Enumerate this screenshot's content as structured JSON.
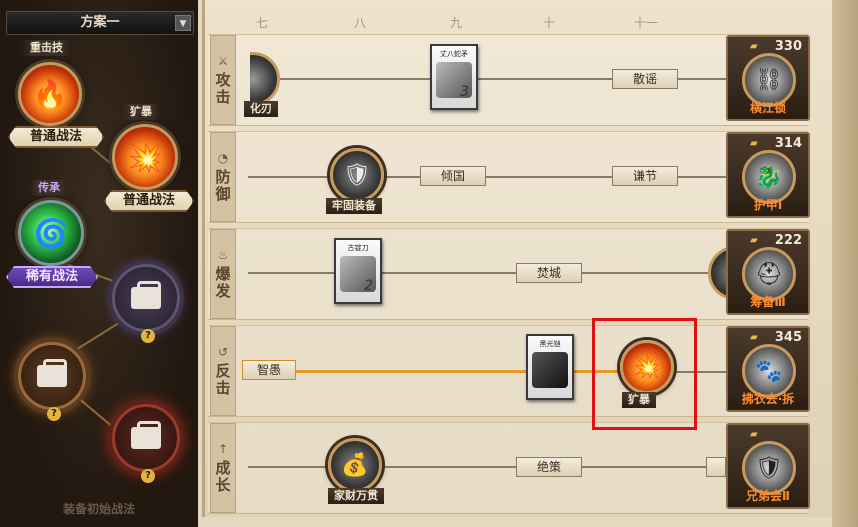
{
  "left_panel": {
    "plan_select": {
      "value": "方案一",
      "arrow_icon": "dropdown-arrow-icon"
    },
    "tags": {
      "heavy_attack": "重击技",
      "fierce": "犷暴",
      "inherit": "传承"
    },
    "labels": {
      "normal_tactic_1": "普通战法",
      "normal_tactic_2": "普通战法",
      "rare_tactic": "稀有战法"
    },
    "locked_slot_badge": "?",
    "bottom_caption": "装备初始战法"
  },
  "columns": [
    "七",
    "八",
    "九",
    "十",
    "十一"
  ],
  "rows": [
    {
      "icon": "swords-icon",
      "label": "攻击",
      "node_label": "化刃",
      "card": {
        "title": "丈八蛇矛",
        "num": "3"
      },
      "pill": "散谣",
      "reward": {
        "count": "330",
        "name": "横江锁"
      }
    },
    {
      "icon": "shield-icon",
      "label": "防御",
      "node_label": "牢固装备",
      "pills": [
        "倾国",
        "谦节"
      ],
      "reward": {
        "count": "314",
        "name": "护甲Ⅰ"
      }
    },
    {
      "icon": "flame-icon",
      "label": "爆发",
      "card": {
        "title": "古锭刀",
        "num": "2"
      },
      "pill": "焚城",
      "reward": {
        "count": "222",
        "name": "筹备Ⅲ"
      }
    },
    {
      "icon": "counter-icon",
      "label": "反击",
      "pill": "智愚",
      "card": {
        "title": "黑光铠"
      },
      "node_label": "犷暴",
      "reward": {
        "count": "345",
        "name": "拂衣去·拆"
      }
    },
    {
      "icon": "arrow-up-icon",
      "label": "成长",
      "node_label": "家财万贯",
      "pill": "绝策",
      "reward": {
        "count": "",
        "name": "兄弟会Ⅱ"
      }
    }
  ]
}
